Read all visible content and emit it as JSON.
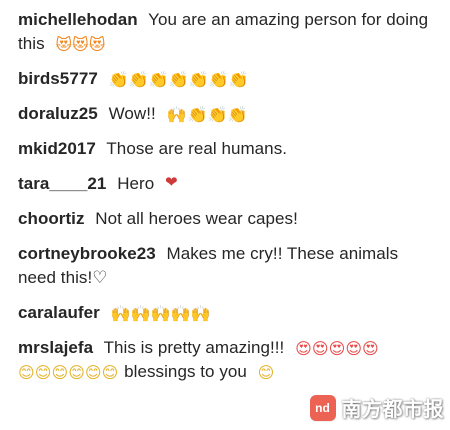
{
  "comments": [
    {
      "user": "michellehodan",
      "text": "You are an amazing person for doing this",
      "emoji": "😻😻😻"
    },
    {
      "user": "birds5777",
      "text": "",
      "emoji": "👏👏👏👏👏👏👏"
    },
    {
      "user": "doraluz25",
      "text": "Wow!!",
      "emoji": "🙌👏👏👏"
    },
    {
      "user": "mkid2017",
      "text": "Those are real humans.",
      "emoji": ""
    },
    {
      "user": "tara____21",
      "text": "Hero",
      "emoji": "❤"
    },
    {
      "user": "choortiz",
      "text": "Not all heroes wear capes!",
      "emoji": ""
    },
    {
      "user": "cortneybrooke23",
      "text": "Makes me cry!! These animals need this!♡",
      "emoji": ""
    },
    {
      "user": "caralaufer",
      "text": "",
      "emoji": "🙌🙌🙌🙌🙌"
    },
    {
      "user": "mrslajefa",
      "text": "This is pretty amazing!!!",
      "emoji": "😍😍😍😍😍😊😊😊😊😊😊 blessings to you 😊"
    }
  ],
  "watermark": {
    "logo_text": "nd",
    "brand_text": "南方都市报"
  }
}
